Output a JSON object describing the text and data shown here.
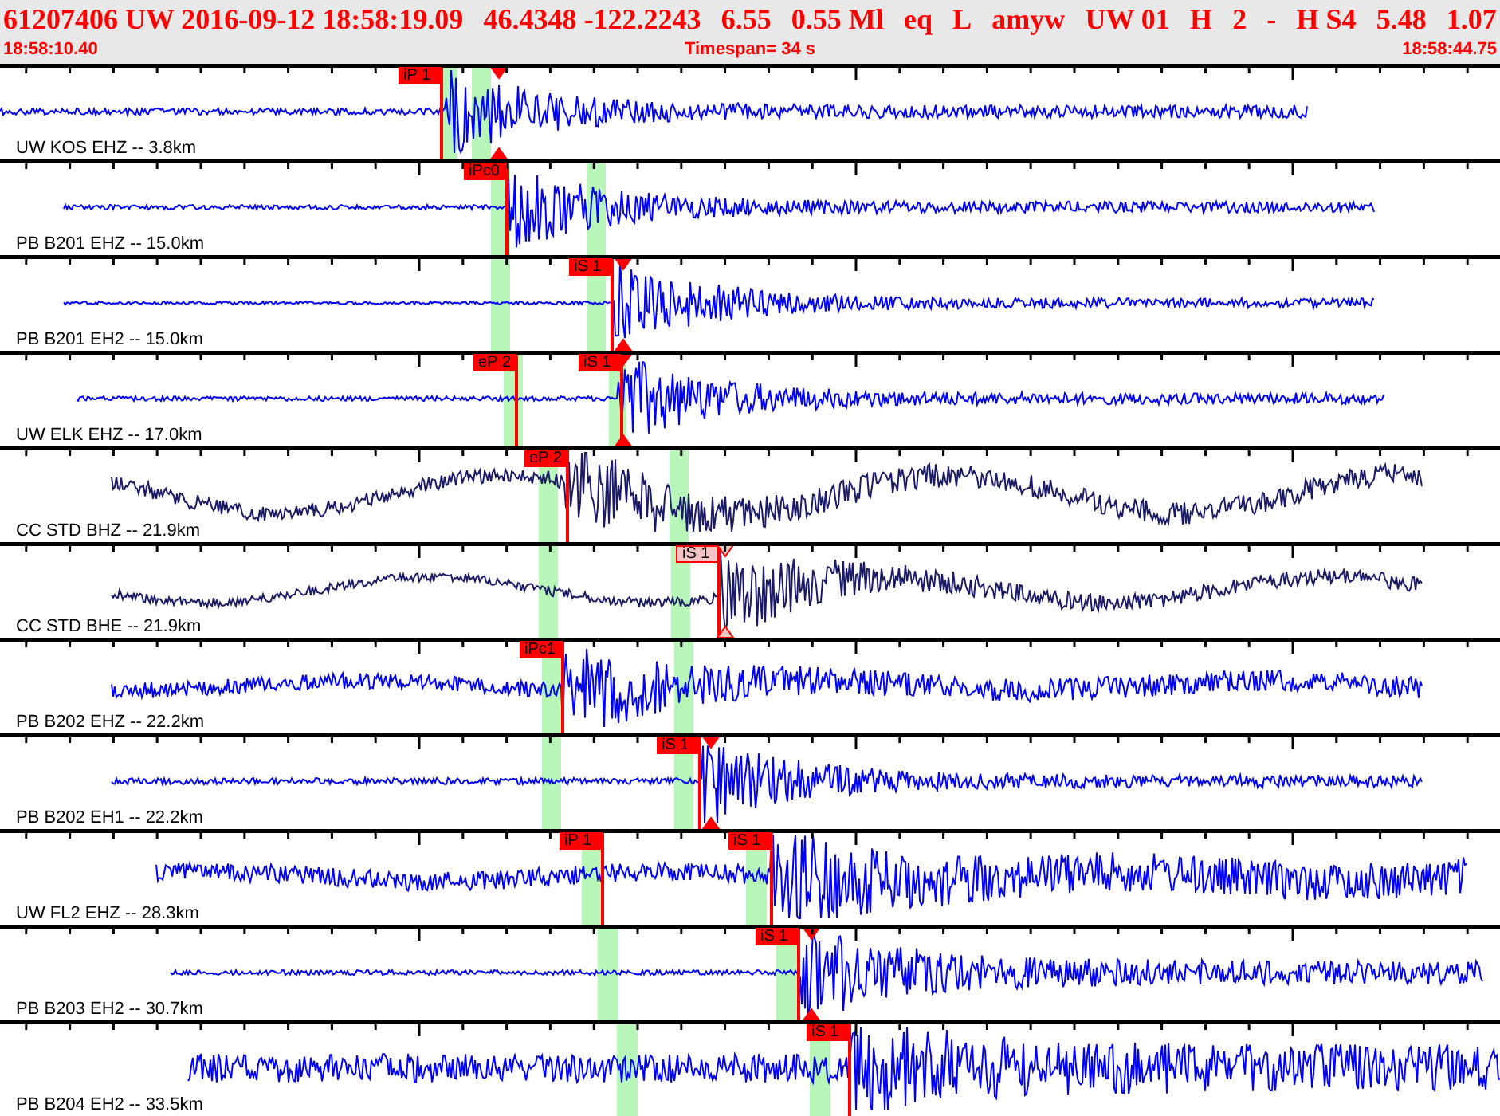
{
  "header": {
    "fields": [
      "61207406 UW 2016-09-12 18:58:19.09",
      "46.4348 -122.2243",
      "6.55",
      "0.55 Ml",
      "eq",
      "L",
      "amyw",
      "UW 01",
      "H",
      "2",
      "-",
      "H S4",
      "5.48",
      "1.07"
    ],
    "start_time": "18:58:10.40",
    "timespan": "Timespan=  34 s",
    "end_time": "18:58:44.75"
  },
  "traces": [
    {
      "station": "UW KOS EHZ -- 3.8km",
      "color": "#0000ff",
      "picks": [
        {
          "label": "iP 1",
          "selected": false
        }
      ]
    },
    {
      "station": "PB B201 EHZ -- 15.0km",
      "color": "#0000ff",
      "picks": [
        {
          "label": "iPc0",
          "selected": false
        }
      ]
    },
    {
      "station": "PB B201 EH2 -- 15.0km",
      "color": "#0000ff",
      "picks": [
        {
          "label": "iS 1",
          "selected": false
        }
      ]
    },
    {
      "station": "UW ELK EHZ -- 17.0km",
      "color": "#0000ff",
      "picks": [
        {
          "label": "eP 2",
          "selected": false
        },
        {
          "label": "iS 1",
          "selected": false
        }
      ]
    },
    {
      "station": "CC STD BHZ -- 21.9km",
      "color": "#1a1a66",
      "picks": [
        {
          "label": "eP 2",
          "selected": false
        }
      ]
    },
    {
      "station": "CC STD BHE -- 21.9km",
      "color": "#1a1a66",
      "picks": [
        {
          "label": "iS 1",
          "selected": true
        }
      ]
    },
    {
      "station": "PB B202 EHZ -- 22.2km",
      "color": "#0000ff",
      "picks": [
        {
          "label": "iPc1",
          "selected": false
        }
      ]
    },
    {
      "station": "PB B202 EH1 -- 22.2km",
      "color": "#0000ff",
      "picks": [
        {
          "label": "iS 1",
          "selected": false
        }
      ]
    },
    {
      "station": "UW FL2 EHZ -- 28.3km",
      "color": "#0000ff",
      "picks": [
        {
          "label": "iP 1",
          "selected": false
        },
        {
          "label": "iS 1",
          "selected": false
        }
      ]
    },
    {
      "station": "PB B203 EH2 -- 30.7km",
      "color": "#0000ff",
      "picks": [
        {
          "label": "iS 1",
          "selected": false
        }
      ]
    },
    {
      "station": "PB B204 EH2 -- 33.5km",
      "color": "#0000ff",
      "picks": [
        {
          "label": "iS 1",
          "selected": false
        }
      ]
    }
  ]
}
